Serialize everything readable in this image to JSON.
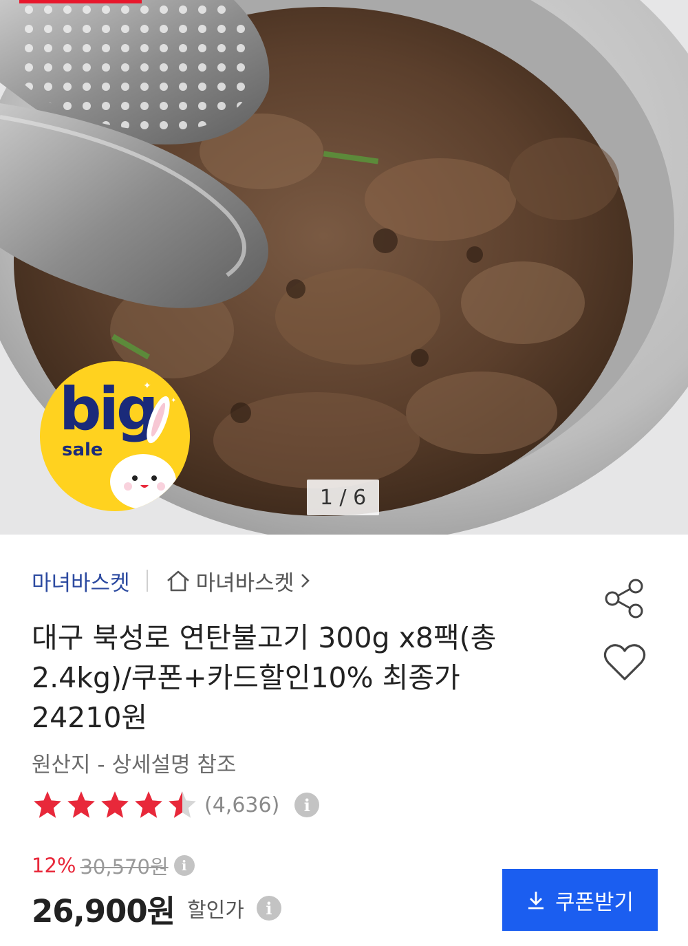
{
  "gallery": {
    "counter": "1 / 6",
    "badge_big": "big",
    "badge_sale": "sale"
  },
  "seller": {
    "name": "마녀바스켓",
    "store_link": "마녀바스켓"
  },
  "product": {
    "title": "대구 북성로 연탄불고기 300g x8팩(총 2.4kg)/쿠폰+카드할인10% 최종가 24210원",
    "origin": "원산지 - 상세설명 참조",
    "rating": 4.5,
    "review_count": "(4,636)"
  },
  "price": {
    "discount_rate": "12%",
    "original_price": "30,570원",
    "sale_price": "26,900원",
    "sale_label": "할인가"
  },
  "actions": {
    "coupon_button": "쿠폰받기"
  },
  "colors": {
    "accent": "#1b5ef0",
    "discount": "#e8283a",
    "star": "#e8283a",
    "seller_link": "#2c4aa0",
    "badge": "#ffd21f"
  },
  "icons": [
    "home-icon",
    "chevron-right-icon",
    "share-icon",
    "heart-icon",
    "star-icon",
    "info-icon",
    "download-icon"
  ]
}
